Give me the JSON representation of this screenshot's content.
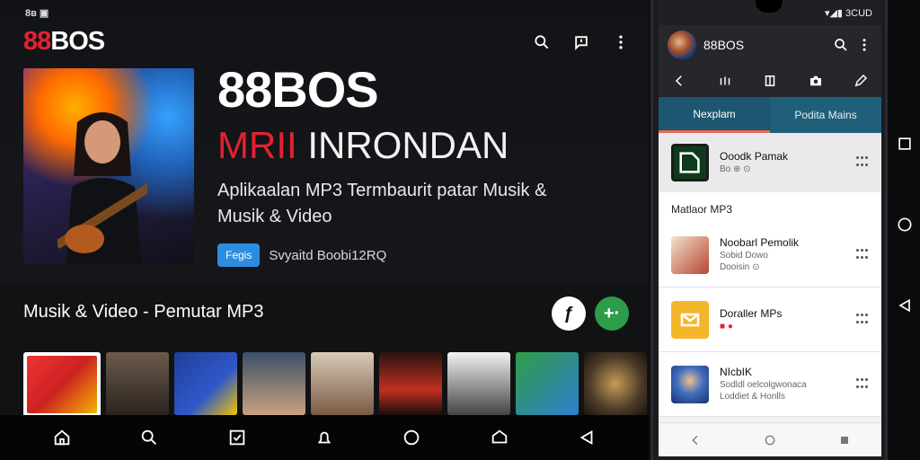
{
  "tablet": {
    "status": "8ʙ ▣",
    "logo": {
      "red": "88",
      "white": "BOS"
    },
    "hero": {
      "title": "88BOS",
      "subtitle_red": "MRII",
      "subtitle_rest": " INRONDAN",
      "description": "Aplikaalan MP3 Termbaurit patar Musik & Musik & Video",
      "badge": "Fegis",
      "meta": "Svyaitd Boobi12RQ"
    },
    "section_title": "Musik & Video - Pemutar MP3"
  },
  "phone": {
    "status": "▾◢▮ 3CUD",
    "app_title": "88BOS",
    "tabs": [
      {
        "label": "Nexplam"
      },
      {
        "label": "Podita Mains"
      }
    ],
    "featured": {
      "name": "Ooodk Pamak",
      "sub": "Bo ⊕ ⊙"
    },
    "list_title": "Matlaor MP3",
    "rows": [
      {
        "name": "Noobarl Pemolik",
        "sub1": "Sobid Dowo",
        "sub2": "Dooisin ⊙"
      },
      {
        "name": "Doraller MPs",
        "sub1": "",
        "sub2": "■ ●"
      },
      {
        "name": "NIcbIK",
        "sub1": "Sodldl oelcolgwonaca",
        "sub2": "Loddiet & Honlls"
      }
    ]
  },
  "colors": {
    "accent_red": "#e32230",
    "badge_blue": "#2c8de0",
    "green_button": "#2e9c4a",
    "tab_bar": "#1f5f79",
    "tab_indicator": "#e46b57"
  }
}
